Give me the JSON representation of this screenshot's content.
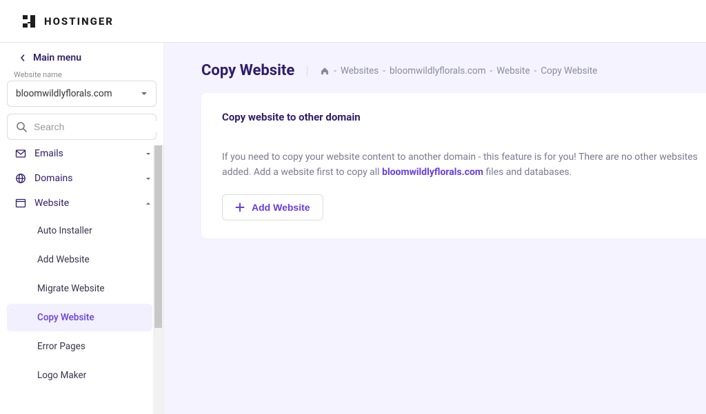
{
  "header": {
    "brand": "HOSTINGER"
  },
  "sidebar": {
    "main_menu_label": "Main menu",
    "website_name_label": "Website name",
    "website_name_value": "bloomwildlyflorals.com",
    "search_placeholder": "Search",
    "nav": {
      "emails": "Emails",
      "domains": "Domains",
      "website": "Website",
      "subs": {
        "auto_installer": "Auto Installer",
        "add_website": "Add Website",
        "migrate_website": "Migrate Website",
        "copy_website": "Copy Website",
        "error_pages": "Error Pages",
        "logo_maker": "Logo Maker"
      }
    }
  },
  "content": {
    "page_title": "Copy Website",
    "breadcrumb": {
      "sep1": "-",
      "websites": "Websites",
      "sep2": "-",
      "domain": "bloomwildlyflorals.com",
      "sep3": "-",
      "website": "Website",
      "sep4": "-",
      "current": "Copy Website"
    },
    "card": {
      "title": "Copy website to other domain",
      "text_before": "If you need to copy your website content to another domain - this feature is for you! There are no other websites added. Add a website first to copy all ",
      "domain_strong": "bloomwildlyflorals.com",
      "text_after": " files and databases.",
      "add_button": "Add Website"
    }
  }
}
